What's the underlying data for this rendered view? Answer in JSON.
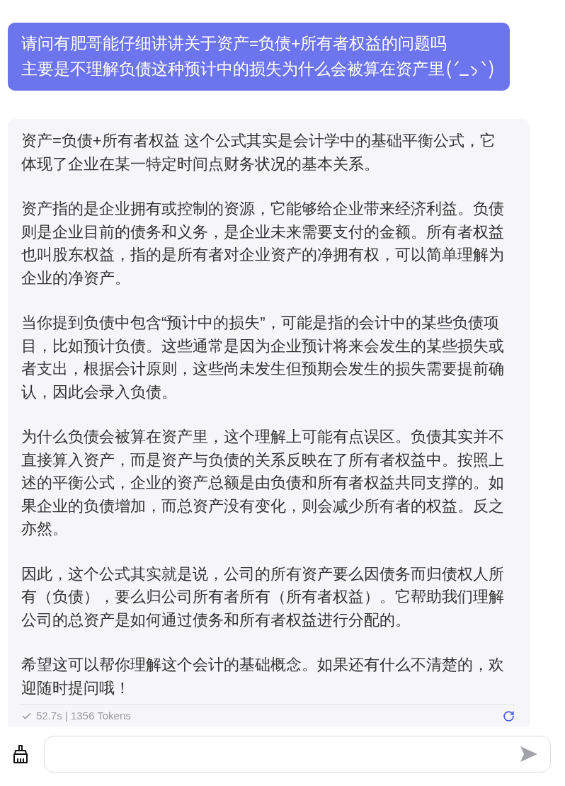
{
  "user_message": {
    "lines": [
      "请问有肥哥能仔细讲讲关于资产=负债+所有者权益的问题吗",
      "主要是不理解负债这种预计中的损失为什么会被算在资产里"
    ]
  },
  "assistant_message": {
    "paragraphs": [
      "资产=负债+所有者权益 这个公式其实是会计学中的基础平衡公式，它体现了企业在某一特定时间点财务状况的基本关系。",
      "资产指的是企业拥有或控制的资源，它能够给企业带来经济利益。负债则是企业目前的债务和义务，是企业未来需要支付的金额。所有者权益也叫股东权益，指的是所有者对企业资产的净拥有权，可以简单理解为企业的净资产。",
      "当你提到负债中包含“预计中的损失”，可能是指的会计中的某些负债项目，比如预计负债。这些通常是因为企业预计将来会发生的某些损失或者支出，根据会计原则，这些尚未发生但预期会发生的损失需要提前确认，因此会录入负债。",
      "为什么负债会被算在资产里，这个理解上可能有点误区。负债其实并不直接算入资产，而是资产与负债的关系反映在了所有者权益中。按照上述的平衡公式，企业的资产总额是由负债和所有者权益共同支撑的。如果企业的负债增加，而总资产没有变化，则会减少所有者的权益。反之亦然。",
      "因此，这个公式其实就是说，公司的所有资产要么因债务而归债权人所有（负债），要么归公司所有者所有（所有者权益）。它帮助我们理解公司的总资产是如何通过债务和所有者权益进行分配的。",
      "希望这可以帮你理解这个会计的基础概念。如果还有什么不清楚的，欢迎随时提问哦！"
    ],
    "stats": "52.7s | 1356 Tokens"
  }
}
